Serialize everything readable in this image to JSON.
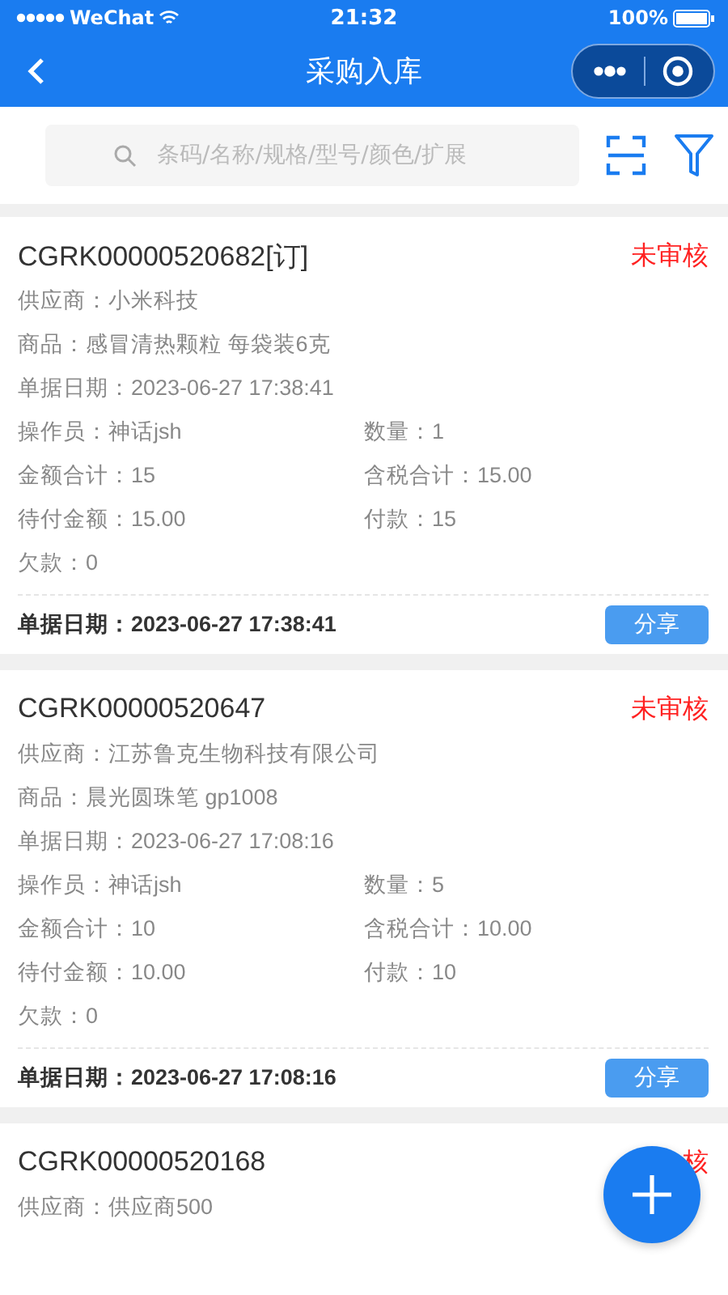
{
  "status_bar": {
    "carrier": "WeChat",
    "time": "21:32",
    "battery": "100%"
  },
  "nav": {
    "title": "采购入库"
  },
  "search": {
    "placeholder": "条码/名称/规格/型号/颜色/扩展"
  },
  "orders": [
    {
      "number": "CGRK00000520682[订]",
      "status": "未审核",
      "fields": [
        {
          "kind": "wide",
          "label": "供应商：",
          "value": "小米科技"
        },
        {
          "kind": "wide",
          "label": "商品：",
          "value": "感冒清热颗粒 每袋装6克"
        },
        {
          "kind": "wide",
          "label": "单据日期：",
          "value": "2023-06-27 17:38:41"
        },
        {
          "kind": "half",
          "label": "操作员：",
          "value": "神话jsh"
        },
        {
          "kind": "half",
          "label": "数量：",
          "value": "1"
        },
        {
          "kind": "half",
          "label": "金额合计：",
          "value": "15"
        },
        {
          "kind": "half",
          "label": "含税合计：",
          "value": "15.00"
        },
        {
          "kind": "half",
          "label": "待付金额：",
          "value": "15.00"
        },
        {
          "kind": "half",
          "label": "付款：",
          "value": "15"
        },
        {
          "kind": "wide",
          "label": "欠款：",
          "value": "0"
        }
      ],
      "footer": {
        "label": "单据日期：",
        "value": "2023-06-27 17:38:41",
        "button": "分享"
      }
    },
    {
      "number": "CGRK00000520647",
      "status": "未审核",
      "fields": [
        {
          "kind": "wide",
          "label": "供应商：",
          "value": "江苏鲁克生物科技有限公司"
        },
        {
          "kind": "wide",
          "label": "商品：",
          "value": "晨光圆珠笔 gp1008"
        },
        {
          "kind": "wide",
          "label": "单据日期：",
          "value": "2023-06-27 17:08:16"
        },
        {
          "kind": "half",
          "label": "操作员：",
          "value": "神话jsh"
        },
        {
          "kind": "half",
          "label": "数量：",
          "value": "5"
        },
        {
          "kind": "half",
          "label": "金额合计：",
          "value": "10"
        },
        {
          "kind": "half",
          "label": "含税合计：",
          "value": "10.00"
        },
        {
          "kind": "half",
          "label": "待付金额：",
          "value": "10.00"
        },
        {
          "kind": "half",
          "label": "付款：",
          "value": "10"
        },
        {
          "kind": "wide",
          "label": "欠款：",
          "value": "0"
        }
      ],
      "footer": {
        "label": "单据日期：",
        "value": "2023-06-27 17:08:16",
        "button": "分享"
      }
    },
    {
      "number": "CGRK00000520168",
      "status": "核",
      "fields": [
        {
          "kind": "wide",
          "label": "供应商：",
          "value": "供应商500"
        }
      ]
    }
  ]
}
